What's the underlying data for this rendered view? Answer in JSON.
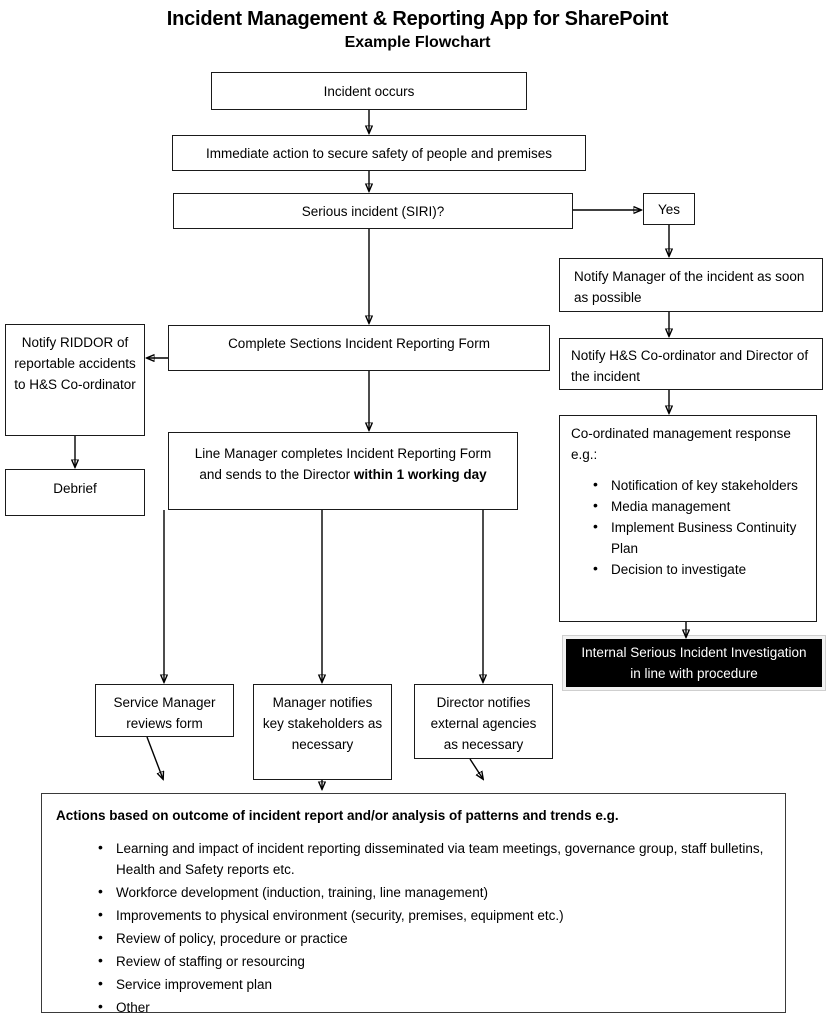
{
  "header": {
    "title": "Incident Management & Reporting App for SharePoint",
    "subtitle": "Example Flowchart"
  },
  "nodes": {
    "incident_occurs": "Incident occurs",
    "immediate_action": "Immediate action to secure safety of people and premises",
    "serious_incident": "Serious incident (SIRI)?",
    "yes": "Yes",
    "notify_manager": "Notify Manager of the incident as soon as possible",
    "notify_hs": "Notify H&S Co-ordinator and Director of the incident",
    "coordinated_response_heading": "Co-ordinated management response e.g.:",
    "coordinated_response_items": [
      "Notification of key stakeholders",
      "Media management",
      "Implement Business Continuity Plan",
      "Decision to investigate"
    ],
    "internal_investigation": "Internal Serious Incident Investigation in line with procedure",
    "notify_riddor": "Notify RIDDOR of reportable accidents to H&S Co-ordinator",
    "debrief": "Debrief",
    "complete_sections": "Complete Sections Incident Reporting Form",
    "line_manager_prefix": "Line Manager completes Incident Reporting Form and sends to the Director ",
    "line_manager_bold": "within 1 working day",
    "service_manager": "Service Manager reviews form",
    "manager_notifies": "Manager notifies key stakeholders as necessary",
    "director_notifies": "Director notifies external agencies as necessary"
  },
  "actions": {
    "heading": "Actions based on outcome of incident report and/or analysis of patterns and trends e.g.",
    "items": [
      "Learning and impact of incident reporting disseminated via team meetings, governance group, staff bulletins, Health and Safety reports etc.",
      "Workforce development (induction, training, line management)",
      "Improvements to physical environment (security, premises, equipment etc.)",
      "Review of policy, procedure or practice",
      "Review of staffing or resourcing",
      "Service improvement plan",
      "Other"
    ]
  },
  "colors": {
    "stroke": "#000000",
    "highlight_bg": "#000000",
    "highlight_text": "#ffffff",
    "page_bg": "#ffffff"
  }
}
